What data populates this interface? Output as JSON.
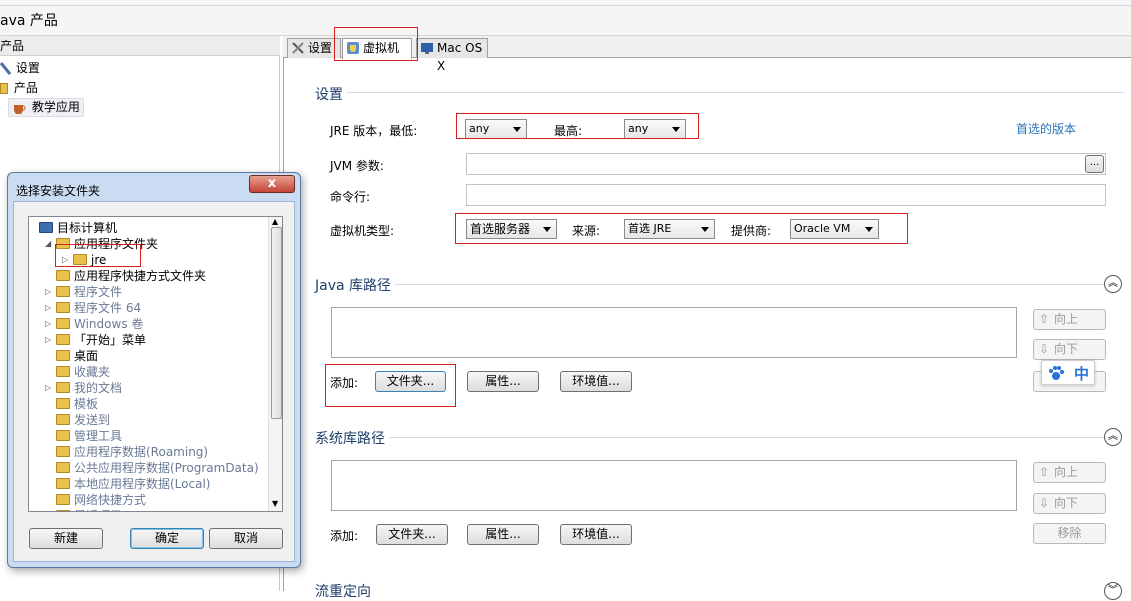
{
  "window": {
    "title": "ava 产品"
  },
  "left_panel": {
    "header": "产品",
    "items": [
      {
        "label": "设置",
        "icon": "wrench-icon"
      },
      {
        "label": "产品",
        "icon": "folder-icon"
      },
      {
        "label": "教学应用",
        "icon": "coffee-cup-icon"
      }
    ]
  },
  "tabs": [
    {
      "label": "设置",
      "icon": "tools-icon"
    },
    {
      "label": "虚拟机",
      "icon": "vm-shield-icon"
    },
    {
      "label": "Mac OS X",
      "icon": "mac-icon"
    }
  ],
  "settings": {
    "title": "设置",
    "jre_min_label": "JRE 版本，最低:",
    "jre_min_value": "any",
    "jre_max_label": "最高:",
    "jre_max_value": "any",
    "preferred_version_link": "首选的版本",
    "jvm_params_label": "JVM 参数:",
    "jvm_params_value": "",
    "browse_label": "...",
    "cmdline_label": "命令行:",
    "cmdline_value": "",
    "vm_type_label": "虚拟机类型:",
    "vm_type_value": "首选服务器",
    "source_label": "来源:",
    "source_value": "首选 JRE",
    "provider_label": "提供商:",
    "provider_value": "Oracle VM"
  },
  "java_lib": {
    "title": "Java 库路径",
    "up": "向上",
    "down": "向下",
    "add_label": "添加:",
    "folder_btn": "文件夹...",
    "property_btn": "属性...",
    "env_btn": "环境值..."
  },
  "sys_lib": {
    "title": "系统库路径",
    "up": "向上",
    "down": "向下",
    "remove": "移除",
    "add_label": "添加:",
    "folder_btn": "文件夹...",
    "property_btn": "属性...",
    "env_btn": "环境值..."
  },
  "redirect": {
    "title": "流重定向"
  },
  "ime": {
    "label": "中"
  },
  "dialog": {
    "title": "选择安装文件夹",
    "close": "x",
    "tree": [
      {
        "label": "目标计算机",
        "level": 0,
        "type": "computer",
        "expander": "",
        "style": "normal"
      },
      {
        "label": "应用程序文件夹",
        "level": 1,
        "type": "folder",
        "expander": "◢",
        "style": "normal"
      },
      {
        "label": "jre",
        "level": 2,
        "type": "folder",
        "expander": "▷",
        "style": "normal"
      },
      {
        "label": "应用程序快捷方式文件夹",
        "level": 1,
        "type": "folder",
        "expander": "",
        "style": "normal"
      },
      {
        "label": "程序文件",
        "level": 1,
        "type": "folder",
        "expander": "▷",
        "style": "gray"
      },
      {
        "label": "程序文件 64",
        "level": 1,
        "type": "folder",
        "expander": "▷",
        "style": "gray"
      },
      {
        "label": "Windows 卷",
        "level": 1,
        "type": "folder",
        "expander": "▷",
        "style": "gray"
      },
      {
        "label": "「开始」菜单",
        "level": 1,
        "type": "folder",
        "expander": "▷",
        "style": "normal"
      },
      {
        "label": "桌面",
        "level": 1,
        "type": "folder",
        "expander": "",
        "style": "normal"
      },
      {
        "label": "收藏夹",
        "level": 1,
        "type": "folder",
        "expander": "",
        "style": "gray"
      },
      {
        "label": "我的文档",
        "level": 1,
        "type": "folder",
        "expander": "▷",
        "style": "gray"
      },
      {
        "label": "模板",
        "level": 1,
        "type": "folder",
        "expander": "",
        "style": "gray"
      },
      {
        "label": "发送到",
        "level": 1,
        "type": "folder",
        "expander": "",
        "style": "gray"
      },
      {
        "label": "管理工具",
        "level": 1,
        "type": "folder",
        "expander": "",
        "style": "gray"
      },
      {
        "label": "应用程序数据(Roaming)",
        "level": 1,
        "type": "folder",
        "expander": "",
        "style": "gray"
      },
      {
        "label": "公共应用程序数据(ProgramData)",
        "level": 1,
        "type": "folder",
        "expander": "",
        "style": "gray"
      },
      {
        "label": "本地应用程序数据(Local)",
        "level": 1,
        "type": "folder",
        "expander": "",
        "style": "gray"
      },
      {
        "label": "网络快捷方式",
        "level": 1,
        "type": "folder",
        "expander": "",
        "style": "gray"
      },
      {
        "label": "最近项目",
        "level": 1,
        "type": "folder",
        "expander": "",
        "style": "gray"
      }
    ],
    "new_btn": "新建",
    "ok_btn": "确定",
    "cancel_btn": "取消"
  },
  "colors": {
    "accent": "#1f3f6b",
    "highlight_box": "#d62020",
    "link": "#2a73b8"
  }
}
